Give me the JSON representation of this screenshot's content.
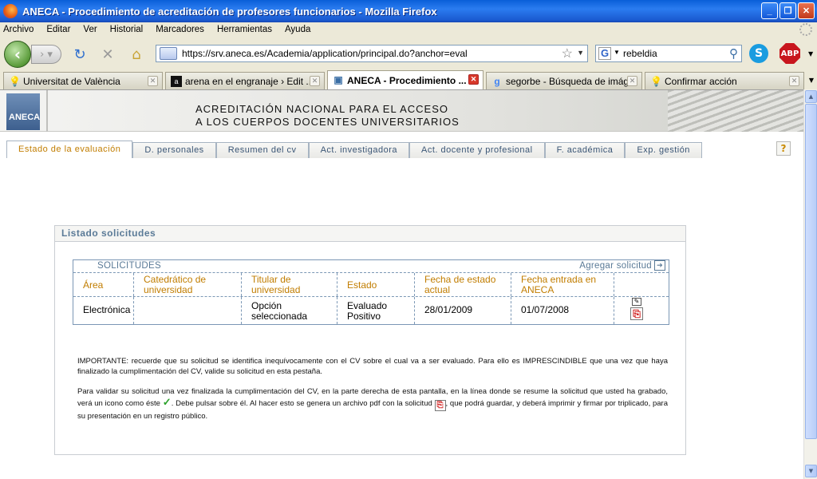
{
  "window": {
    "title": "ANECA - Procedimiento de acreditación de profesores funcionarios - Mozilla Firefox"
  },
  "menu": [
    "Archivo",
    "Editar",
    "Ver",
    "Historial",
    "Marcadores",
    "Herramientas",
    "Ayuda"
  ],
  "toolbar": {
    "url": "https://srv.aneca.es/Academia/application/principal.do?anchor=eval",
    "search_value": "rebeldia",
    "search_engine": "G",
    "abp_label": "ABP"
  },
  "browser_tabs": [
    {
      "label": "Universitat de València",
      "active": false
    },
    {
      "label": "arena en el engranaje › Edit ...",
      "active": false
    },
    {
      "label": "ANECA - Procedimiento ...",
      "active": true
    },
    {
      "label": "segorbe - Búsqueda de imág...",
      "active": false
    },
    {
      "label": "Confirmar acción",
      "active": false
    }
  ],
  "header": {
    "logo_text": "ANECA",
    "title_line1": "ACREDITACIÓN NACIONAL PARA EL ACCESO",
    "title_line2": "A LOS CUERPOS DOCENTES UNIVERSITARIOS"
  },
  "app_tabs": [
    {
      "label": "Estado de la evaluación",
      "active": true
    },
    {
      "label": "D. personales",
      "active": false
    },
    {
      "label": "Resumen del cv",
      "active": false
    },
    {
      "label": "Act. investigadora",
      "active": false
    },
    {
      "label": "Act. docente y profesional",
      "active": false
    },
    {
      "label": "F. académica",
      "active": false
    },
    {
      "label": "Exp. gestión",
      "active": false
    }
  ],
  "help_label": "?",
  "panel": {
    "title": "Listado solicitudes",
    "table_title": "SOLICITUDES",
    "add_link": "Agregar solicitud",
    "headers": [
      "Área",
      "Catedrático de universidad",
      "Titular de universidad",
      "Estado",
      "Fecha de estado actual",
      "Fecha entrada en ANECA",
      ""
    ],
    "rows": [
      {
        "area": "Electrónica",
        "catedratico": "",
        "titular": "Opción seleccionada",
        "estado": "Evaluado Positivo",
        "fecha_estado": "28/01/2009",
        "fecha_entrada": "01/07/2008"
      }
    ]
  },
  "notice": {
    "p1": "IMPORTANTE: recuerde que su solicitud se identifica inequívocamente con el CV sobre el cual va a ser evaluado. Para ello es IMPRESCINDIBLE que una vez que haya finalizado la cumplimentación del CV, valide su solicitud en esta pestaña.",
    "p2_a": "Para validar su solicitud una vez finalizada la cumplimentación del CV, en la parte derecha de esta pantalla, en la línea donde se resume la solicitud que usted ha grabado, verá un icono como éste",
    "p2_b": ". Debe pulsar sobre él. Al hacer esto se genera un archivo pdf con la solicitud",
    "p2_c": ", que podrá guardar, y deberá imprimir y firmar por triplicado, para su presentación en un registro público."
  },
  "colors": {
    "accent_orange": "#c17d00",
    "table_border": "#7b97b5",
    "label_blue": "#5a7a97"
  }
}
